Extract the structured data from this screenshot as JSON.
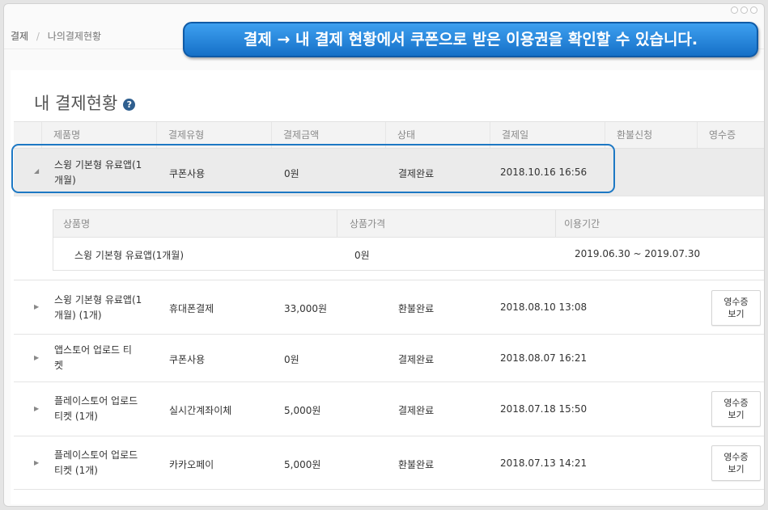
{
  "breadcrumb": {
    "root": "결제",
    "separator": "/",
    "current": "나의결제현황"
  },
  "banner": {
    "text": "결제 → 내 결제 현황에서 쿠폰으로 받은 이용권을 확인할 수 있습니다."
  },
  "page": {
    "title": "내 결제현황",
    "help_icon": "question-circle-icon",
    "help_glyph": "?"
  },
  "table": {
    "columns": [
      "제품명",
      "결제유형",
      "결제금액",
      "상태",
      "결제일",
      "환불신청",
      "영수증"
    ],
    "rows": [
      {
        "product": "스윙 기본형 유료앱(1\n개월)",
        "type": "쿠폰사용",
        "amount": "0원",
        "status": "결제완료",
        "date": "2018.10.16 16:56",
        "receipt": "",
        "expanded": true,
        "arrow": "◢"
      },
      {
        "product": "스윙 기본형 유료앱(1\n개월) (1개)",
        "type": "휴대폰결제",
        "amount": "33,000원",
        "status": "환불완료",
        "date": "2018.08.10 13:08",
        "receipt": "영수증\n보기",
        "arrow": "▶"
      },
      {
        "product": "앱스토어 업로드 티\n켓",
        "type": "쿠폰사용",
        "amount": "0원",
        "status": "결제완료",
        "date": "2018.08.07 16:21",
        "receipt": "",
        "arrow": "▶"
      },
      {
        "product": "플레이스토어 업로드\n티켓 (1개)",
        "type": "실시간계좌이체",
        "amount": "5,000원",
        "status": "결제완료",
        "date": "2018.07.18 15:50",
        "receipt": "영수증\n보기",
        "arrow": "▶"
      },
      {
        "product": "플레이스토어 업로드\n티켓 (1개)",
        "type": "카카오페이",
        "amount": "5,000원",
        "status": "환불완료",
        "date": "2018.07.13 14:21",
        "receipt": "영수증\n보기",
        "arrow": "▶"
      }
    ]
  },
  "detail": {
    "columns": [
      "상품명",
      "상품가격",
      "이용기간"
    ],
    "row": {
      "name": "스윙 기본형 유료앱(1개월)",
      "price": "0원",
      "period": "2019.06.30 ~ 2019.07.30"
    }
  },
  "colors": {
    "accent": "#1d78c4",
    "banner_top": "#3ea0f0",
    "banner_bottom": "#1670c7",
    "help_icon": "#2f5f8f"
  }
}
